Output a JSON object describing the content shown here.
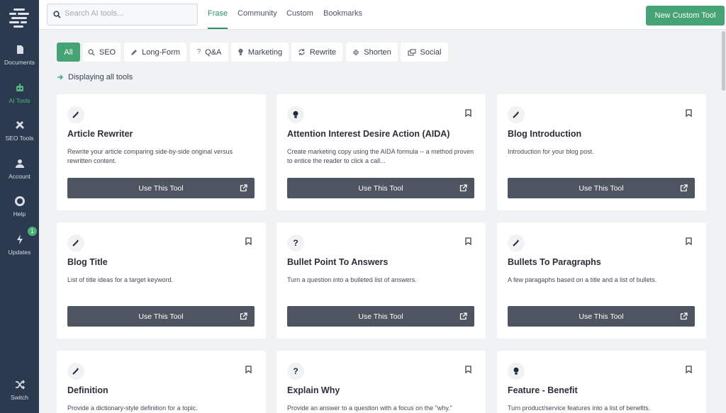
{
  "sidebar": {
    "logo": "frase-logo",
    "items": [
      {
        "label": "Documents",
        "icon": "document-icon"
      },
      {
        "label": "AI Tools",
        "icon": "robot-icon",
        "active": true
      },
      {
        "label": "SEO Tools",
        "icon": "tools-icon"
      },
      {
        "label": "Account",
        "icon": "user-icon"
      },
      {
        "label": "Help",
        "icon": "lifebuoy-icon"
      },
      {
        "label": "Updates",
        "icon": "bolt-icon",
        "badge": "1"
      },
      {
        "label": "Switch",
        "icon": "shuffle-icon"
      }
    ]
  },
  "header": {
    "search_placeholder": "Search AI tools...",
    "tabs": [
      "Frase",
      "Community",
      "Custom",
      "Bookmarks"
    ],
    "active_tab": "Frase",
    "new_button": "New Custom Tool"
  },
  "filters": [
    {
      "label": "All",
      "icon": "",
      "active": true
    },
    {
      "label": "SEO",
      "icon": "search-icon"
    },
    {
      "label": "Long-Form",
      "icon": "pencil-icon"
    },
    {
      "label": "Q&A",
      "icon": "question-icon"
    },
    {
      "label": "Marketing",
      "icon": "lightbulb-icon"
    },
    {
      "label": "Rewrite",
      "icon": "refresh-icon"
    },
    {
      "label": "Shorten",
      "icon": "compress-icon"
    },
    {
      "label": "Social",
      "icon": "social-icon"
    }
  ],
  "display_text": "Displaying all tools",
  "use_button_label": "Use This Tool",
  "colors": {
    "accent": "#46a373",
    "sidebar": "#2b3a4e",
    "button": "#4e5561"
  },
  "cards": [
    {
      "title": "Article Rewriter",
      "desc": "Rewrite your article comparing side-by-side original versus rewritten content.",
      "icon": "magic-wand-icon",
      "bookmark": false
    },
    {
      "title": "Attention Interest Desire Action (AIDA)",
      "desc": "Create marketing copy using the AIDA formula -- a method proven to entice the reader to click a call...",
      "icon": "lightbulb-icon",
      "bookmark": true
    },
    {
      "title": "Blog Introduction",
      "desc": "Introduction for your blog post.",
      "icon": "magic-wand-icon",
      "bookmark": true
    },
    {
      "title": "Blog Title",
      "desc": "List of title ideas for a target keyword.",
      "icon": "magic-wand-icon",
      "bookmark": true
    },
    {
      "title": "Bullet Point To Answers",
      "desc": "Turn a question into a bulleted list of answers.",
      "icon": "question-icon",
      "bookmark": true
    },
    {
      "title": "Bullets To Paragraphs",
      "desc": "A few paragaphs based on a title and a list of bullets.",
      "icon": "magic-wand-icon",
      "bookmark": true
    },
    {
      "title": "Definition",
      "desc": "Provide a dictionary-style definition for a topic.",
      "icon": "magic-wand-icon",
      "bookmark": true
    },
    {
      "title": "Explain Why",
      "desc": "Provide an answer to a question with a focus on the \"why.\"",
      "icon": "question-icon",
      "bookmark": true
    },
    {
      "title": "Feature - Benefit",
      "desc": "Turn product/service features into a list of benefits.",
      "icon": "lightbulb-icon",
      "bookmark": true
    }
  ]
}
